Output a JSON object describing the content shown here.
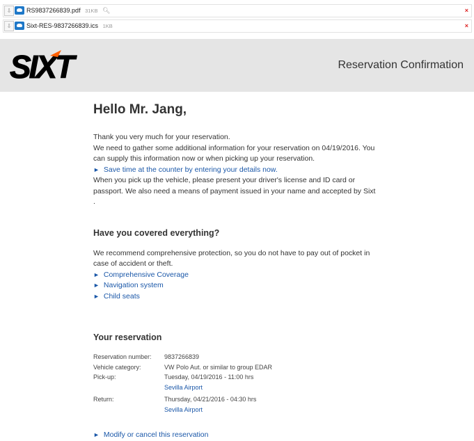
{
  "attachments": [
    {
      "name": "RS9837266839.pdf",
      "size": "31KB",
      "has_search": true
    },
    {
      "name": "Sixt-RES-9837266839.ics",
      "size": "1KB",
      "has_search": false
    }
  ],
  "header": {
    "logo_text": "SIXT",
    "title": "Reservation Confirmation"
  },
  "greeting": "Hello Mr. Jang,",
  "intro": {
    "line1": "Thank you very much for your reservation.",
    "line2": "We need to gather some additional information for your reservation on 04/19/2016. You can supply this information now or when picking up your reservation.",
    "link": "Save time at the counter by entering your details now.",
    "line3": "When you pick up the vehicle, please present your driver's license and ID card or passport. We also need a means of payment issued in your name and accepted by Sixt ."
  },
  "coverage": {
    "heading": "Have you covered everything?",
    "text": "We recommend comprehensive protection, so you do not have to pay out of pocket in case of accident or theft.",
    "links": [
      "Comprehensive Coverage",
      "Navigation system",
      "Child seats"
    ]
  },
  "reservation": {
    "heading": "Your reservation",
    "number_label": "Reservation number:",
    "number": "9837266839",
    "category_label": "Vehicle category:",
    "category": "VW Polo Aut. or similar to group EDAR",
    "pickup_label": "Pick-up:",
    "pickup_date": "Tuesday, 04/19/2016 - 11:00 hrs",
    "pickup_location": "Sevilla Airport",
    "return_label": "Return:",
    "return_date": "Thursday, 04/21/2016 - 04:30 hrs",
    "return_location": "Sevilla Airport",
    "modify_link": "Modify or cancel this reservation"
  },
  "colors": {
    "link": "#1a57a8",
    "sixt_orange": "#ff5f00",
    "header_bg": "#e5e5e5"
  }
}
